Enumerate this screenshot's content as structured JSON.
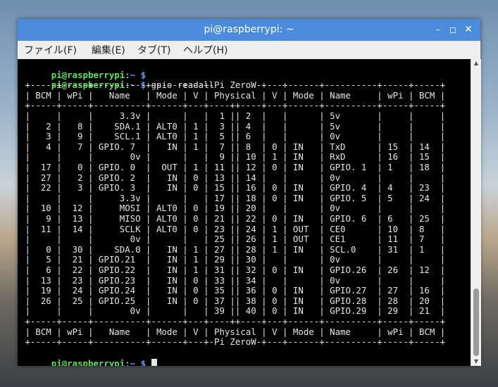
{
  "window": {
    "title": "pi@raspberrypi: ~",
    "controls": {
      "minimize": "–",
      "maximize": "◻",
      "close": "✕"
    }
  },
  "menu": [
    {
      "label": "ファイル(F)"
    },
    {
      "label": "編集(E)"
    },
    {
      "label": "タブ(T)"
    },
    {
      "label": "ヘルプ(H)"
    }
  ],
  "prompt": {
    "user_host": "pi@raspberrypi",
    "sep": ":",
    "path": "~",
    "symbol": " $"
  },
  "command": "gpio readall",
  "output": [
    " +-----+-----+----------+------+---+-Pi ZeroW-+---+------+----------+-----+-----+",
    " | BCM | wPi |   Name   | Mode | V | Physical | V | Mode | Name     | wPi | BCM |",
    " +-----+-----+----------+------+---+----++----+---+------+----------+-----+-----+",
    " |     |     |     3.3v |      |   |  1 || 2  |   |      | 5v       |     |     |",
    " |   2 |   8 |    SDA.1 | ALT0 | 1 |  3 || 4  |   |      | 5v       |     |     |",
    " |   3 |   9 |    SCL.1 | ALT0 | 1 |  5 || 6  |   |      | 0v       |     |     |",
    " |   4 |   7 | GPIO. 7  |   IN | 1 |  7 || 8  | 0 | IN   | TxD      | 15  | 14  |",
    " |     |     |       0v |      |   |  9 || 10 | 1 | IN   | RxD      | 16  | 15  |",
    " |  17 |   0 | GPIO. 0  |  OUT | 1 | 11 || 12 | 0 | IN   | GPIO. 1  | 1   | 18  |",
    " |  27 |   2 | GPIO. 2  |   IN | 0 | 13 || 14 |   |      | 0v       |     |     |",
    " |  22 |   3 | GPIO. 3  |   IN | 0 | 15 || 16 | 0 | IN   | GPIO. 4  | 4   | 23  |",
    " |     |     |     3.3v |      |   | 17 || 18 | 0 | IN   | GPIO. 5  | 5   | 24  |",
    " |  10 |  12 |     MOSI | ALT0 | 0 | 19 || 20 |   |      | 0v       |     |     |",
    " |   9 |  13 |     MISO | ALT0 | 0 | 21 || 22 | 0 | IN   | GPIO. 6  | 6   | 25  |",
    " |  11 |  14 |     SCLK | ALT0 | 0 | 23 || 24 | 1 | OUT  | CE0      | 10  | 8   |",
    " |     |     |       0v |      |   | 25 || 26 | 1 | OUT  | CE1      | 11  | 7   |",
    " |   0 |  30 |    SDA.0 |   IN | 1 | 27 || 28 | 1 | IN   | SCL.0    | 31  | 1   |",
    " |   5 |  21 | GPIO.21  |   IN | 1 | 29 || 30 |   |      | 0v       |     |     |",
    " |   6 |  22 | GPIO.22  |   IN | 1 | 31 || 32 | 0 | IN   | GPIO.26  | 26  | 12  |",
    " |  13 |  23 | GPIO.23  |   IN | 0 | 33 || 34 |   |      | 0v       |     |     |",
    " |  19 |  24 | GPIO.24  |   IN | 0 | 35 || 36 | 0 | IN   | GPIO.27  | 27  | 16  |",
    " |  26 |  25 | GPIO.25  |   IN | 0 | 37 || 38 | 0 | IN   | GPIO.28  | 28  | 20  |",
    " |     |     |       0v |      |   | 39 || 40 | 0 | IN   | GPIO.29  | 29  | 21  |",
    " +-----+-----+----------+------+---+----++----+---+------+----------+-----+-----+",
    " | BCM | wPi |   Name   | Mode | V | Physical | V | Mode | Name     | wPi | BCM |",
    " +-----+-----+----------+------+---+-Pi ZeroW-+---+------+----------+-----+-----+"
  ],
  "scrollbar": {
    "up_icon": "▲",
    "down_icon": "▼"
  }
}
